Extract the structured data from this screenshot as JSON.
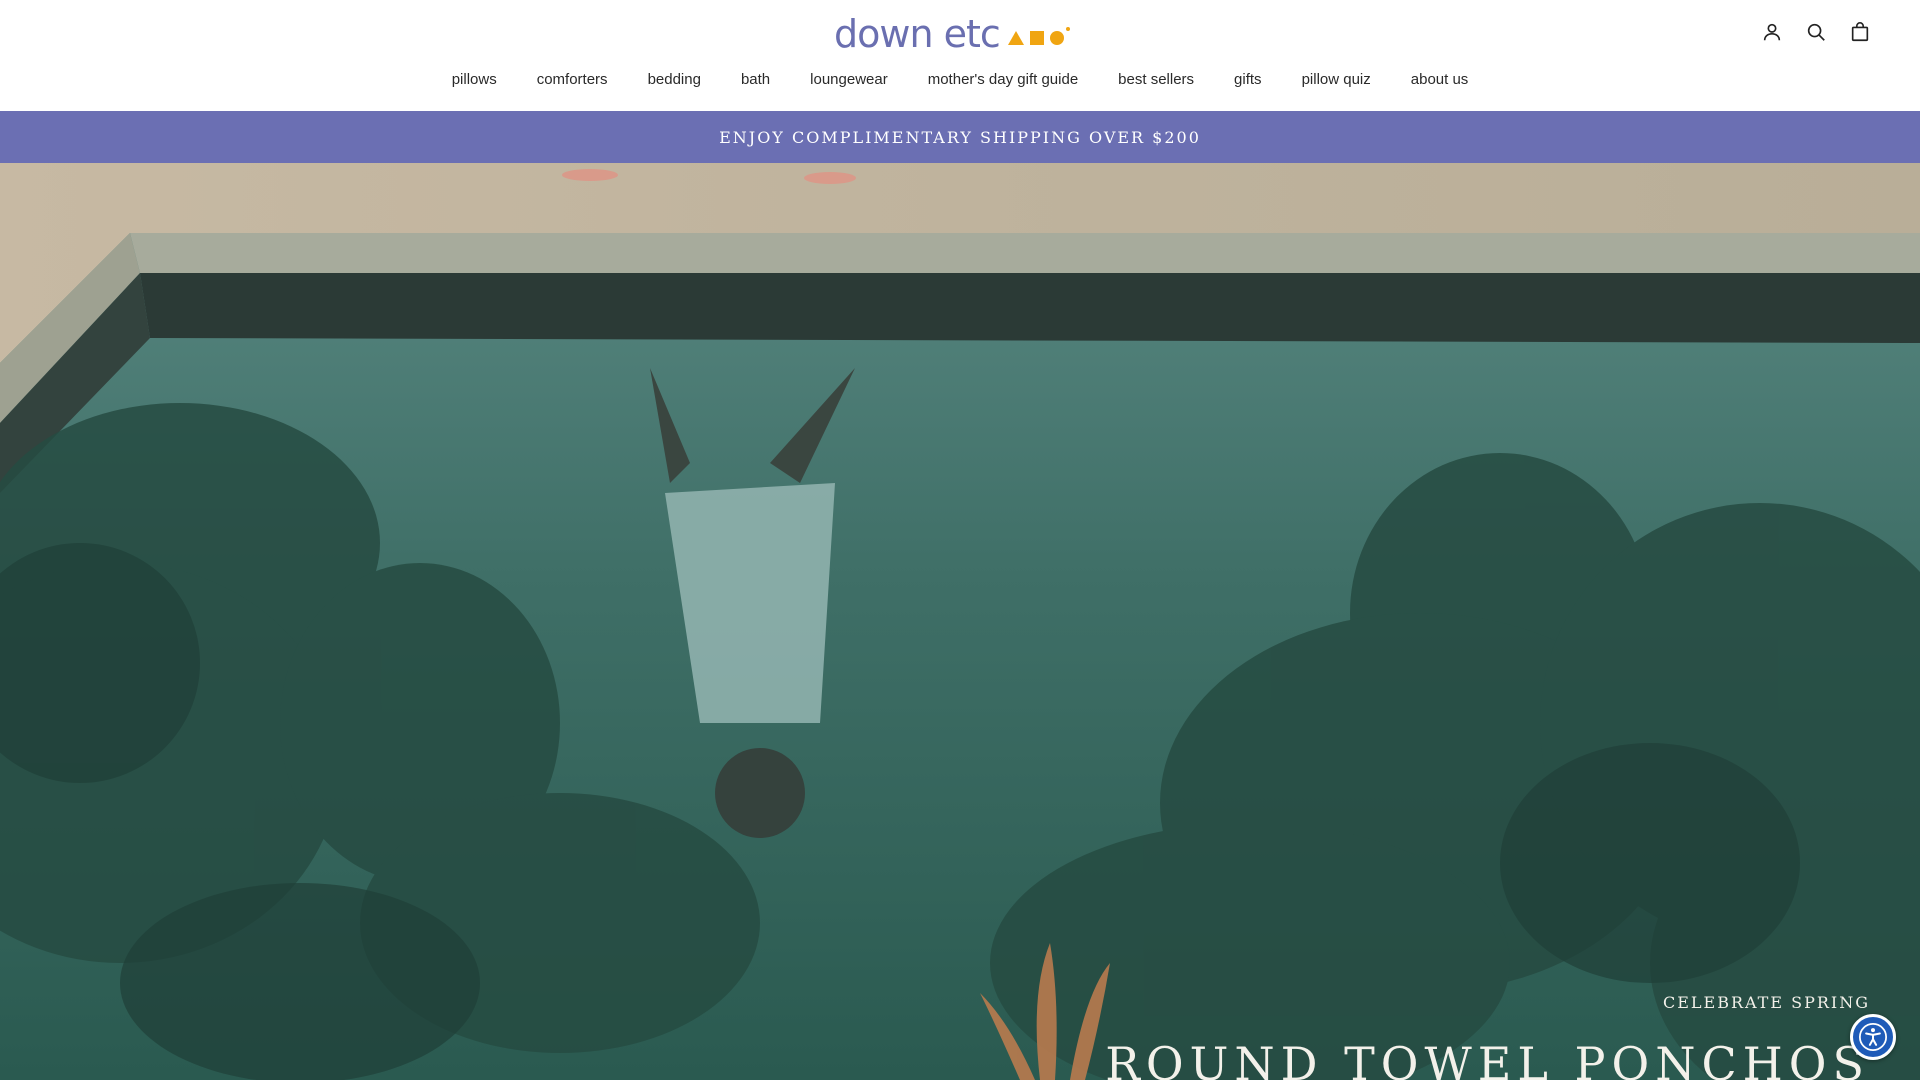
{
  "brand": {
    "logo_text": "down etc",
    "logo_color": "#6a6fb0",
    "shape_color": "#f0a512"
  },
  "header_icons": [
    {
      "name": "account-icon"
    },
    {
      "name": "search-icon"
    },
    {
      "name": "cart-icon"
    }
  ],
  "nav": {
    "items": [
      {
        "label": "pillows"
      },
      {
        "label": "comforters"
      },
      {
        "label": "bedding"
      },
      {
        "label": "bath"
      },
      {
        "label": "loungewear"
      },
      {
        "label": "mother's day gift guide"
      },
      {
        "label": "best sellers"
      },
      {
        "label": "gifts"
      },
      {
        "label": "pillow quiz"
      },
      {
        "label": "about us"
      }
    ]
  },
  "promo": {
    "text": "ENJOY COMPLIMENTARY SHIPPING OVER $200",
    "background": "#6b6fb3"
  },
  "hero": {
    "eyebrow": "CELEBRATE SPRING",
    "title": "ROUND TOWEL PONCHOS"
  },
  "accessibility": {
    "icon": "accessibility-icon",
    "color": "#1f5bb8"
  }
}
